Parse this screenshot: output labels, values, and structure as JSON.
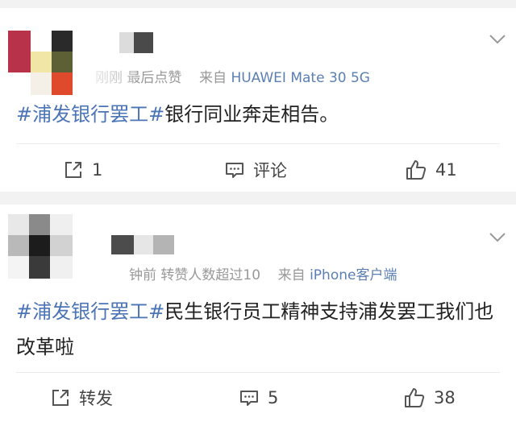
{
  "posts": [
    {
      "meta": {
        "time": "刚刚",
        "note": "最后点赞",
        "from_label": "来自",
        "source": "HUAWEI Mate 30 5G"
      },
      "content": {
        "hashtag": "#浦发银行罢工#",
        "text": "银行同业奔走相告。"
      },
      "actions": {
        "share": "1",
        "comment": "评论",
        "like": "41"
      }
    },
    {
      "meta": {
        "time": "钟前",
        "note": "转赞人数超过10",
        "from_label": "来自",
        "source": "iPhone客户端"
      },
      "content": {
        "hashtag": "#浦发银行罢工#",
        "text": "民生银行员工精神支持浦发罢工我们也改革啦"
      },
      "actions": {
        "share": "转发",
        "comment": "5",
        "like": "38"
      }
    }
  ],
  "colors": {
    "hashtag": "#4a74b6",
    "source_link": "#5b7fb2",
    "background": "#f2f2f2"
  },
  "icons": [
    "share-icon",
    "comment-icon",
    "like-icon",
    "chevron-down-icon"
  ]
}
